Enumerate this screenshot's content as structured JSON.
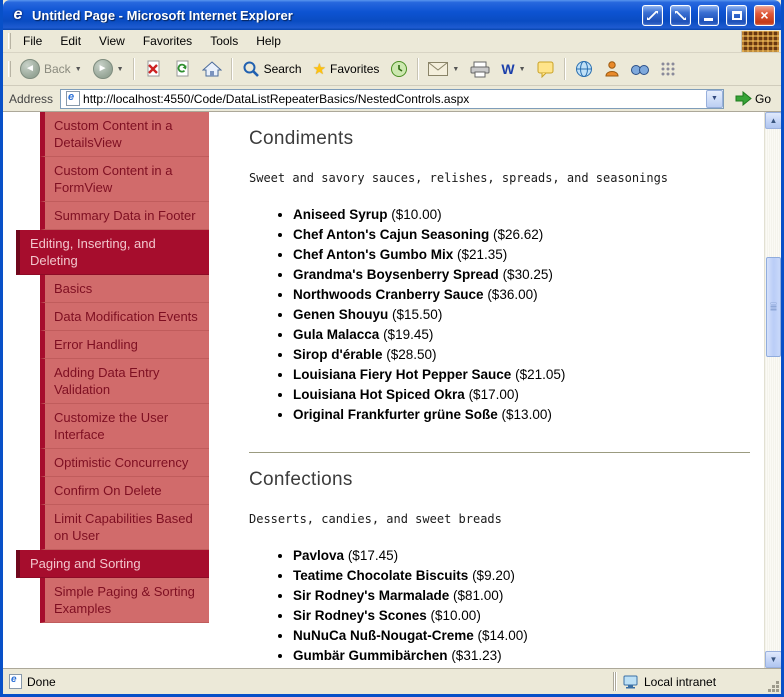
{
  "window": {
    "title": "Untitled Page - Microsoft Internet Explorer"
  },
  "menu": {
    "items": [
      "File",
      "Edit",
      "View",
      "Favorites",
      "Tools",
      "Help"
    ]
  },
  "toolbar": {
    "back_label": "Back",
    "search_label": "Search",
    "favorites_label": "Favorites",
    "word_label": "W"
  },
  "address": {
    "label": "Address",
    "url": "http://localhost:4550/Code/DataListRepeaterBasics/NestedControls.aspx",
    "go_label": "Go"
  },
  "icons": {
    "back": "◄",
    "forward": "►",
    "home": "⌂",
    "favorites": "★",
    "dropdown": "▼",
    "scroll_up": "▲",
    "scroll_down": "▼",
    "close": "×"
  },
  "colors": {
    "titlebar_blue": "#0D53D2",
    "close_red": "#C43A18",
    "sidebar_header_bg": "#A60D2D",
    "sidebar_item_bg": "#D16B6B",
    "sidebar_header_text": "#F2C6CC",
    "sidebar_item_text": "#7E0F22",
    "go_green": "#37A437"
  },
  "sidebar": {
    "items": [
      {
        "label": "Custom Content in a DetailsView",
        "type": "sub"
      },
      {
        "label": "Custom Content in a FormView",
        "type": "sub"
      },
      {
        "label": "Summary Data in Footer",
        "type": "sub"
      },
      {
        "label": "Editing, Inserting, and Deleting",
        "type": "header"
      },
      {
        "label": "Basics",
        "type": "sub"
      },
      {
        "label": "Data Modification Events",
        "type": "sub"
      },
      {
        "label": "Error Handling",
        "type": "sub"
      },
      {
        "label": "Adding Data Entry Validation",
        "type": "sub"
      },
      {
        "label": "Customize the User Interface",
        "type": "sub"
      },
      {
        "label": "Optimistic Concurrency",
        "type": "sub"
      },
      {
        "label": "Confirm On Delete",
        "type": "sub"
      },
      {
        "label": "Limit Capabilities Based on User",
        "type": "sub"
      },
      {
        "label": "Paging and Sorting",
        "type": "header"
      },
      {
        "label": "Simple Paging & Sorting Examples",
        "type": "sub"
      }
    ]
  },
  "content": {
    "sections": [
      {
        "title": "Condiments",
        "description": "Sweet and savory sauces, relishes, spreads, and seasonings",
        "products": [
          {
            "name": "Aniseed Syrup",
            "price": "($10.00)"
          },
          {
            "name": "Chef Anton's Cajun Seasoning",
            "price": "($26.62)"
          },
          {
            "name": "Chef Anton's Gumbo Mix",
            "price": "($21.35)"
          },
          {
            "name": "Grandma's Boysenberry Spread",
            "price": "($30.25)"
          },
          {
            "name": "Northwoods Cranberry Sauce",
            "price": "($36.00)"
          },
          {
            "name": "Genen Shouyu",
            "price": "($15.50)"
          },
          {
            "name": "Gula Malacca",
            "price": "($19.45)"
          },
          {
            "name": "Sirop d'érable",
            "price": "($28.50)"
          },
          {
            "name": "Louisiana Fiery Hot Pepper Sauce",
            "price": "($21.05)"
          },
          {
            "name": "Louisiana Hot Spiced Okra",
            "price": "($17.00)"
          },
          {
            "name": "Original Frankfurter grüne Soße",
            "price": "($13.00)"
          }
        ]
      },
      {
        "title": "Confections",
        "description": "Desserts, candies, and sweet breads",
        "products": [
          {
            "name": "Pavlova",
            "price": "($17.45)"
          },
          {
            "name": "Teatime Chocolate Biscuits",
            "price": "($9.20)"
          },
          {
            "name": "Sir Rodney's Marmalade",
            "price": "($81.00)"
          },
          {
            "name": "Sir Rodney's Scones",
            "price": "($10.00)"
          },
          {
            "name": "NuNuCa Nuß-Nougat-Creme",
            "price": "($14.00)"
          },
          {
            "name": "Gumbär Gummibärchen",
            "price": "($31.23)"
          }
        ]
      }
    ]
  },
  "status": {
    "left": "Done",
    "right": "Local intranet"
  }
}
